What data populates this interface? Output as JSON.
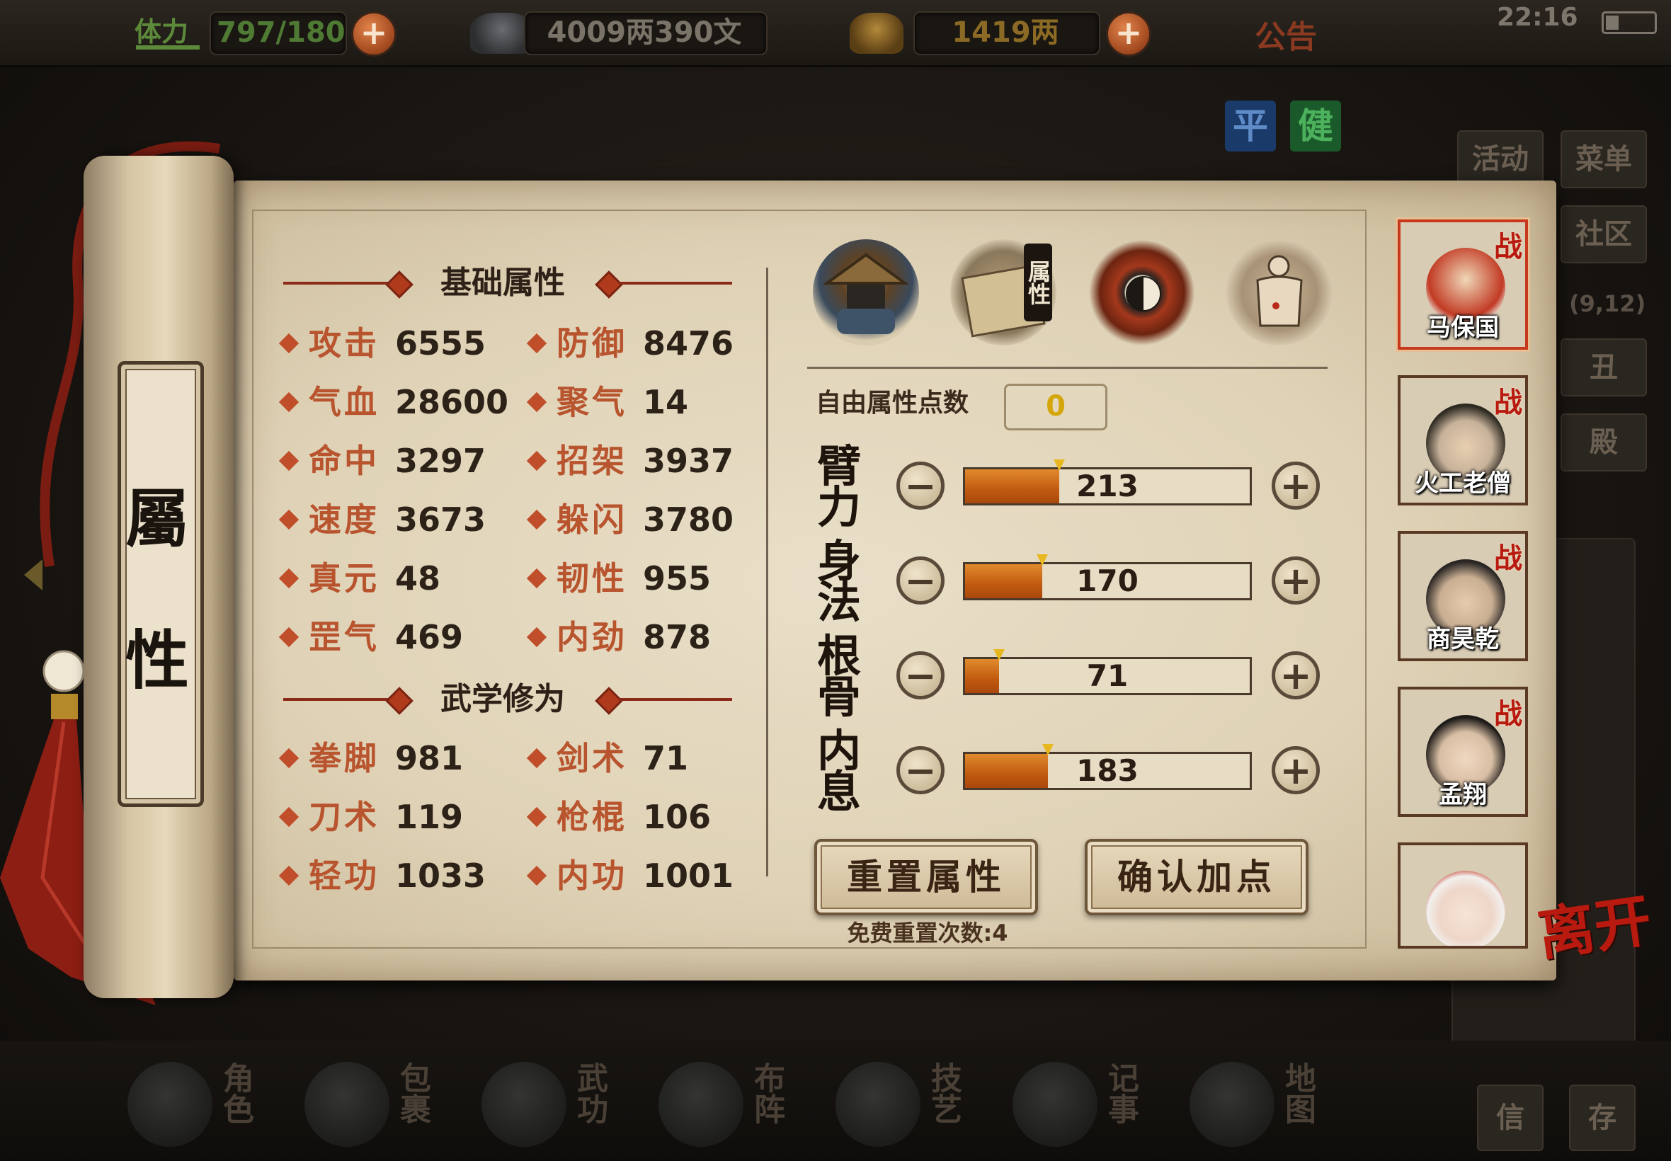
{
  "topbar": {
    "stamina_label": "体力",
    "stamina_value": "797/180",
    "silver_value": "4009两390文",
    "gold_value": "1419两",
    "notice_label": "公告",
    "clock": "22:16"
  },
  "mode_buttons": [
    "平",
    "健"
  ],
  "side_buttons": {
    "activity": "活动",
    "menu": "菜单",
    "community": "社区",
    "coords": "(9,12)",
    "misc": "丑",
    "hall": "殿"
  },
  "scroll_title": [
    "屬",
    "性"
  ],
  "basic": {
    "title": "基础属性",
    "stats": [
      {
        "name": "攻击",
        "value": "6555"
      },
      {
        "name": "防御",
        "value": "8476"
      },
      {
        "name": "气血",
        "value": "28600"
      },
      {
        "name": "聚气",
        "value": "14"
      },
      {
        "name": "命中",
        "value": "3297"
      },
      {
        "name": "招架",
        "value": "3937"
      },
      {
        "name": "速度",
        "value": "3673"
      },
      {
        "name": "躲闪",
        "value": "3780"
      },
      {
        "name": "真元",
        "value": "48"
      },
      {
        "name": "韧性",
        "value": "955"
      },
      {
        "name": "罡气",
        "value": "469"
      },
      {
        "name": "内劲",
        "value": "878"
      }
    ]
  },
  "martial": {
    "title": "武学修为",
    "stats": [
      {
        "name": "拳脚",
        "value": "981"
      },
      {
        "name": "剑术",
        "value": "71"
      },
      {
        "name": "刀术",
        "value": "119"
      },
      {
        "name": "枪棍",
        "value": "106"
      },
      {
        "name": "轻功",
        "value": "1033"
      },
      {
        "name": "内功",
        "value": "1001"
      }
    ]
  },
  "tabs": {
    "attribute_tab_label": "属性"
  },
  "free_points": {
    "label": "自由属性点数",
    "value": "0"
  },
  "attributes": [
    {
      "label": "臂力",
      "value": "213",
      "fill": 0.33
    },
    {
      "label": "身法",
      "value": "170",
      "fill": 0.27
    },
    {
      "label": "根骨",
      "value": "71",
      "fill": 0.12
    },
    {
      "label": "内息",
      "value": "183",
      "fill": 0.29
    }
  ],
  "actions": {
    "reset": "重置属性",
    "confirm": "确认加点",
    "reset_note": "免费重置次数:4"
  },
  "characters": [
    {
      "name": "马保国",
      "tag": "战"
    },
    {
      "name": "火工老僧",
      "tag": "战"
    },
    {
      "name": "商昊乾",
      "tag": "战"
    },
    {
      "name": "孟翔",
      "tag": "战"
    },
    {
      "name": "",
      "tag": ""
    }
  ],
  "leave_label": "离开",
  "dock": [
    "角色",
    "包裹",
    "武功",
    "布阵",
    "技艺",
    "记事",
    "地图"
  ],
  "dock_right": [
    "信",
    "存"
  ],
  "colors": {
    "accent_red": "#b81a10",
    "bar_orange": "#c15a10",
    "parchment": "#e9dfc8",
    "stat_name": "#b8542e"
  }
}
